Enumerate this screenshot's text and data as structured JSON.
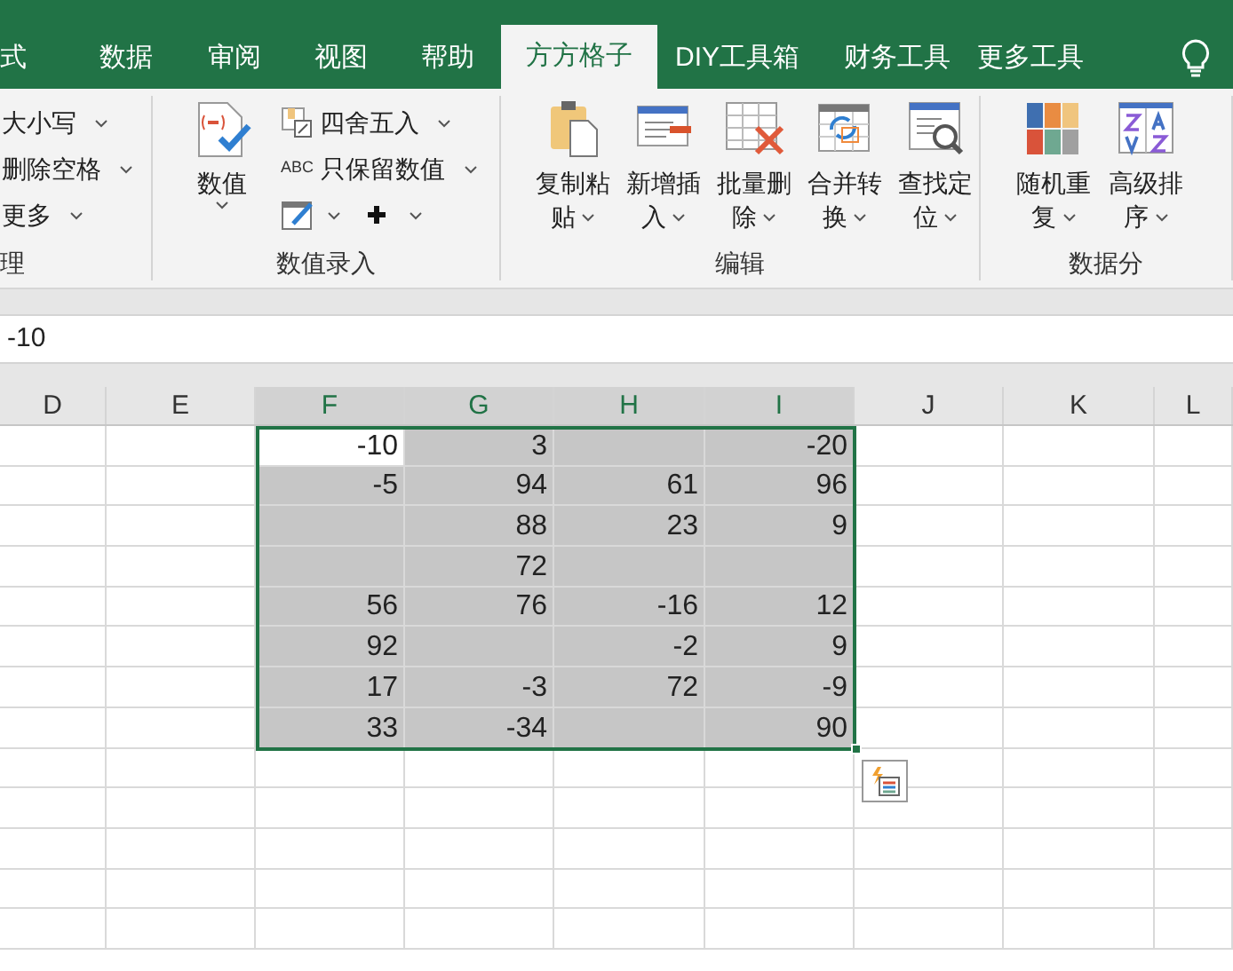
{
  "tabs": [
    {
      "label": "式",
      "selected": false
    },
    {
      "label": "数据",
      "selected": false
    },
    {
      "label": "审阅",
      "selected": false
    },
    {
      "label": "视图",
      "selected": false
    },
    {
      "label": "帮助",
      "selected": false
    },
    {
      "label": "方方格子",
      "selected": true
    },
    {
      "label": "DIY工具箱",
      "selected": false
    },
    {
      "label": "财务工具",
      "selected": false
    },
    {
      "label": "更多工具",
      "selected": false
    }
  ],
  "ribbon": {
    "groups": [
      {
        "label": "理",
        "kind": "small",
        "items": [
          {
            "label": "大小写"
          },
          {
            "label": "删除空格"
          },
          {
            "label": "更多"
          }
        ]
      },
      {
        "label": "数值录入",
        "kind": "mixed",
        "big": {
          "line1": "数值"
        },
        "items": [
          {
            "label": "四舍五入"
          },
          {
            "prefix": "ABC",
            "label": "只保留数值"
          }
        ]
      },
      {
        "label": "编辑",
        "kind": "big",
        "items": [
          {
            "line1": "复制粘",
            "line2": "贴"
          },
          {
            "line1": "新增插",
            "line2": "入"
          },
          {
            "line1": "批量删",
            "line2": "除"
          },
          {
            "line1": "合并转",
            "line2": "换"
          },
          {
            "line1": "查找定",
            "line2": "位"
          }
        ]
      },
      {
        "label": "数据分",
        "kind": "big",
        "items": [
          {
            "line1": "随机重",
            "line2": "复"
          },
          {
            "line1": "高级排",
            "line2": "序"
          }
        ]
      }
    ]
  },
  "formula_bar": {
    "value": "-10"
  },
  "columns": [
    "D",
    "E",
    "F",
    "G",
    "H",
    "I",
    "J",
    "K",
    "L"
  ],
  "rows": [
    {
      "selected": true,
      "active": true,
      "cells": {
        "F": "-10",
        "G": "3",
        "I": "-20"
      }
    },
    {
      "selected": true,
      "cells": {
        "F": "-5",
        "G": "94",
        "H": "61",
        "I": "96"
      }
    },
    {
      "selected": true,
      "cells": {
        "G": "88",
        "H": "23",
        "I": "9"
      }
    },
    {
      "selected": true,
      "cells": {
        "G": "72"
      }
    },
    {
      "selected": true,
      "cells": {
        "F": "56",
        "G": "76",
        "H": "-16",
        "I": "12"
      }
    },
    {
      "selected": true,
      "cells": {
        "F": "92",
        "H": "-2",
        "I": "9"
      }
    },
    {
      "selected": true,
      "cells": {
        "F": "17",
        "G": "-3",
        "H": "72",
        "I": "-9"
      }
    },
    {
      "selected": true,
      "cells": {
        "F": "33",
        "G": "-34",
        "I": "90"
      }
    }
  ]
}
